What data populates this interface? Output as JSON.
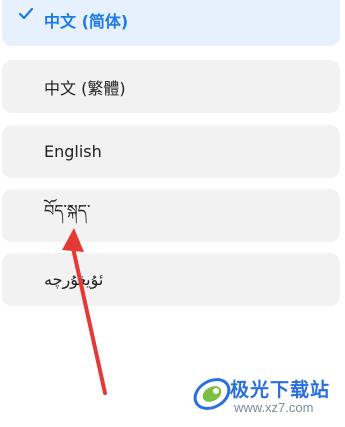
{
  "language_list": {
    "items": [
      {
        "label": "中文 (简体)",
        "selected": true
      },
      {
        "label": "中文 (繁體)",
        "selected": false
      },
      {
        "label": "English",
        "selected": false
      },
      {
        "label": "བོད་སྐད་",
        "selected": false
      },
      {
        "label": "ئۇيغۇرچە",
        "selected": false
      }
    ]
  },
  "icons": {
    "check": "check-icon",
    "watermark_logo": "logo-icon"
  },
  "colors": {
    "selected_bg": "#e6f1fd",
    "selected_text": "#1e7ae6",
    "item_bg": "#f2f2f2",
    "arrow": "#e53935"
  },
  "watermark": {
    "name": "极光下载站",
    "url": "www.xz7.com"
  }
}
